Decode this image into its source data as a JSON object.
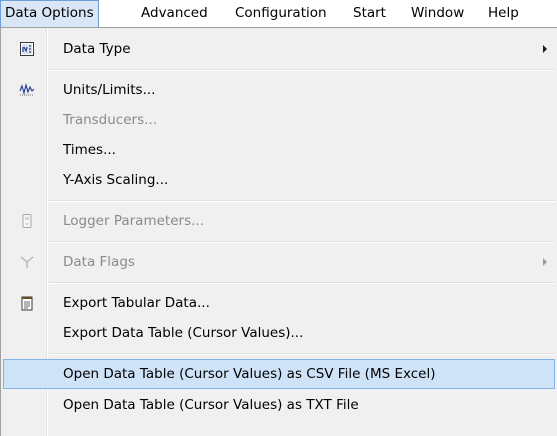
{
  "menubar": {
    "items": [
      {
        "label": "Data Options"
      },
      {
        "label": "Advanced"
      },
      {
        "label": "Configuration"
      },
      {
        "label": "Start"
      },
      {
        "label": "Window"
      },
      {
        "label": "Help"
      }
    ]
  },
  "dropdown": {
    "data_type": "Data Type",
    "units_limits": "Units/Limits...",
    "transducers": "Transducers...",
    "times": "Times...",
    "y_axis_scaling": "Y-Axis Scaling...",
    "logger_parameters": "Logger Parameters...",
    "data_flags": "Data Flags",
    "export_tabular": "Export Tabular Data...",
    "export_data_table": "Export Data Table (Cursor Values)...",
    "open_csv": "Open Data Table (Cursor Values) as CSV File (MS Excel)",
    "open_txt": "Open Data Table (Cursor Values) as TXT File"
  },
  "icons": {
    "data_type": "data-type-icon",
    "units_limits": "waveform-icon",
    "logger_parameters": "logger-icon",
    "data_flags": "flag-icon",
    "export_tabular": "notepad-icon"
  },
  "colors": {
    "highlight_bg": "#cfe3f8",
    "highlight_border": "#82b2e6",
    "disabled_text": "#8a8a8a"
  }
}
